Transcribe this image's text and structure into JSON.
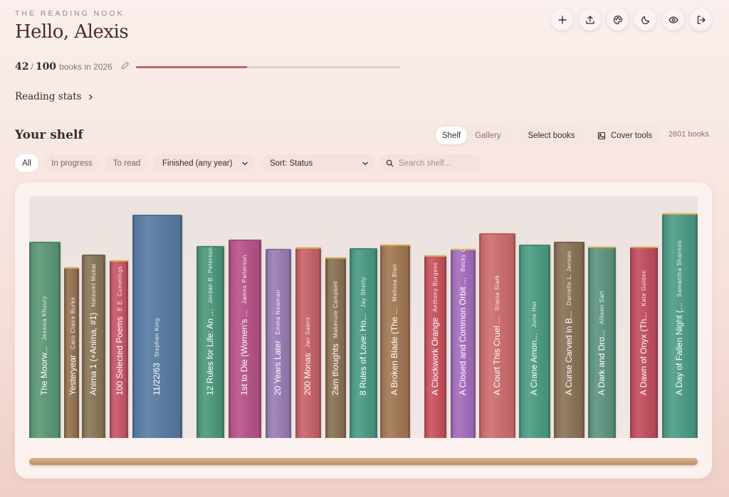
{
  "header": {
    "eyebrow": "THE READING NOOK",
    "greeting": "Hello, Alexis"
  },
  "goal": {
    "read": "42",
    "total": "100",
    "label": "books in 2026",
    "progress_fraction": 0.42
  },
  "stats_link": "Reading stats",
  "shelf": {
    "title": "Your shelf",
    "view_options": [
      "Shelf",
      "Gallery"
    ],
    "active_view": "Shelf",
    "select_books": "Select books",
    "cover_tools": "Cover tools",
    "count": "2601 books"
  },
  "filters": {
    "chips": [
      "All",
      "In progress",
      "To read"
    ],
    "active": "All",
    "finished": "Finished (any year)",
    "sort": "Sort: Status",
    "search_placeholder": "Search shelf..."
  },
  "toolbar_icons": [
    "plus-icon",
    "upload-icon",
    "palette-icon",
    "moon-icon",
    "eye-icon",
    "logout-icon"
  ],
  "books": [
    {
      "title": "The Moorw...",
      "author": "Jessica Khoury",
      "color": "#5e9a78",
      "band": "#4f8868"
    },
    {
      "title": "Yesteryear",
      "author": "Caro Claire Burke",
      "color": "#977455",
      "band": "#d4a84a"
    },
    {
      "title": "Anima 1 (+Anima, #1)",
      "author": "Natsumi Mukai",
      "color": "#8c7858",
      "band": "#7a6a4c"
    },
    {
      "title": "100 Selected Poems",
      "author": "E.E. Cummings",
      "color": "#c9586a",
      "band": "#d9b04a"
    },
    {
      "title": "11/22/63",
      "author": "Stephen King",
      "color": "#5b7ea6",
      "band": "#4f6f94"
    },
    {
      "title": "12 Rules for Life: An ...",
      "author": "Jordan B. Peterson",
      "color": "#4f9a7e",
      "band": "#418a6e"
    },
    {
      "title": "1st to Die (Women's ...",
      "author": "James Patterson",
      "color": "#b9568a",
      "band": "#a6497a"
    },
    {
      "title": "20 Years Later",
      "author": "Emma Newman",
      "color": "#9b7fb8",
      "band": "#8a6fa6"
    },
    {
      "title": "200 Monas",
      "author": "Jan Saenz",
      "color": "#c9646b",
      "band": "#d9a84a"
    },
    {
      "title": "2am thoughts",
      "author": "Makenzie Campbell",
      "color": "#8c7456",
      "band": "#d4a84a"
    },
    {
      "title": "8 Rules of Love: Ho...",
      "author": "Jay Shetty",
      "color": "#4d9c86",
      "band": "#3f8c76"
    },
    {
      "title": "A Broken Blade (The ...",
      "author": "Melissa Blair",
      "color": "#a47a56",
      "band": "#d4a84a"
    },
    {
      "title": "A Clockwork Orange",
      "author": "Anthony Burgess",
      "color": "#cb5560",
      "band": "#d9b04a"
    },
    {
      "title": "A Closed and Common Orbit ...",
      "author": "Becky Chambers",
      "color": "#a66fbf",
      "band": "#d9b04a"
    },
    {
      "title": "A Court This Cruel ...",
      "author": "Stacia Stark",
      "color": "#d06f6f",
      "band": "#c05f5f"
    },
    {
      "title": "A Crane Amon...",
      "author": "June Hur",
      "color": "#4f9e86",
      "band": "#418e76"
    },
    {
      "title": "A Curse Carved in B...",
      "author": "Danielle L. Jensen",
      "color": "#8c7458",
      "band": "#7a6448"
    },
    {
      "title": "A Dark and Dro...",
      "author": "Allison Saft",
      "color": "#5f9682",
      "band": "#d4a84a"
    },
    {
      "title": "A Dawn of Onyx (Th...",
      "author": "Kate Golden",
      "color": "#c44f60",
      "band": "#d9a84a"
    },
    {
      "title": "A Day of Fallen Night (...",
      "author": "Samantha Shannon",
      "color": "#4f9e88",
      "band": "#d9b04a"
    }
  ]
}
